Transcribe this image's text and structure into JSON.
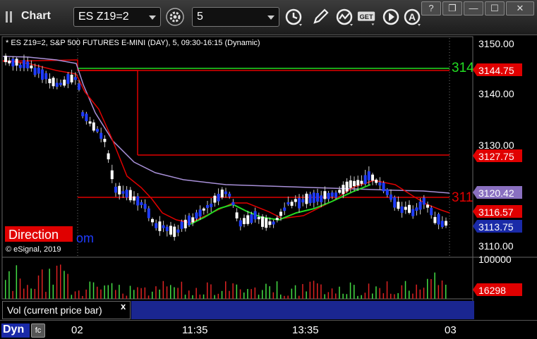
{
  "window": {
    "app_title": "Chart",
    "symbol": "ES Z19=2",
    "interval": "5",
    "win_help": "?",
    "win_restore": "❐",
    "win_minimize": "—",
    "win_maximize": "☐",
    "win_close": "✕"
  },
  "toolbar": {
    "get_label": "GET",
    "alert_label": "A"
  },
  "chart": {
    "info_line": "* ES Z19=2, S&P 500 FUTURES E-MINI (DAY), 5, 09:30-16:15 (Dynamic)",
    "direction_label": "Direction",
    "direction_suffix": "om",
    "copyright": "© eSignal, 2019",
    "left_line_label_green": "314",
    "left_line_label_red": "311",
    "price_ticks": [
      "3150.00",
      "3140.00",
      "3130.00",
      "3110.00"
    ],
    "price_tags": {
      "upper_red": "3144.75",
      "mid_red": "3127.75",
      "purple": "3120.42",
      "lower_red": "3116.57",
      "last_price": "3113.75"
    },
    "volume_tick": "100000",
    "volume_tag": "16298",
    "colors": {
      "red_line": "#e00000",
      "green_line": "#22dd22",
      "purple_line": "#a890d8",
      "up_candle": "#ffffff",
      "down_candle": "#1f3cff",
      "last_price_tag": "#1a2aa8",
      "purple_tag": "#8a70c0"
    }
  },
  "volume_panel": {
    "title": "Vol (current price bar)",
    "close_label": "x"
  },
  "time_axis": {
    "dyn_label": "Dyn",
    "dyn_icon": "fc",
    "labels": [
      "02",
      "11:35",
      "13:35",
      "03"
    ]
  }
}
